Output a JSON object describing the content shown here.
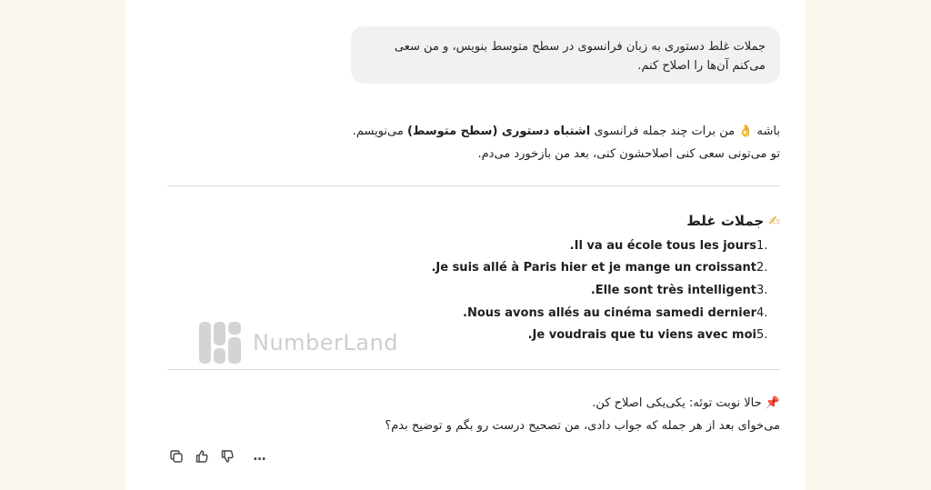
{
  "user_message": {
    "line1": "جملات غلط دستوری به زبان فرانسوی در سطح متوسط بنویس، و من سعی",
    "line2": "می‌کنم آن‌ها را اصلاح کنم."
  },
  "assistant": {
    "intro_prefix": "باشه",
    "intro_emoji": "👌",
    "intro_text_a": "من برات چند جمله فرانسوی",
    "intro_bold": "اشتباه دستوری (سطح متوسط)",
    "intro_text_b": "می‌نویسم.",
    "intro_line2": "تو می‌تونی سعی کنی اصلاحشون کنی، بعد من بازخورد می‌دم.",
    "heading_emoji": "✍",
    "heading": "جملات غلط",
    "sentences": [
      {
        "num": "1.",
        "text": "Il va au école tous les jours."
      },
      {
        "num": "2.",
        "text": "Je suis allé à Paris hier et je mange un croissant."
      },
      {
        "num": "3.",
        "text": "Elle sont très intelligent."
      },
      {
        "num": "4.",
        "text": "Nous avons allés au cinéma samedi dernier."
      },
      {
        "num": "5.",
        "text": "Je voudrais que tu viens avec moi."
      }
    ],
    "outro_emoji": "📌",
    "outro_line1": "حالا نوبت توئه: یکی‌یکی اصلاح کن.",
    "outro_line2": "می‌خوای بعد از هر جمله که جواب دادی، من تصحیح درست رو بگم و توضیح بدم؟"
  },
  "actions": {
    "copy_icon": "copy-icon",
    "thumbs_up_icon": "thumbs-up-icon",
    "thumbs_down_icon": "thumbs-down-icon",
    "more_icon": "more-icon",
    "more_label": "…"
  },
  "watermark": {
    "text": "NumberLand"
  },
  "colors": {
    "page_background": "#fbf8ef",
    "bubble": "#f1f1f1",
    "watermark": "#c9c9c9"
  }
}
